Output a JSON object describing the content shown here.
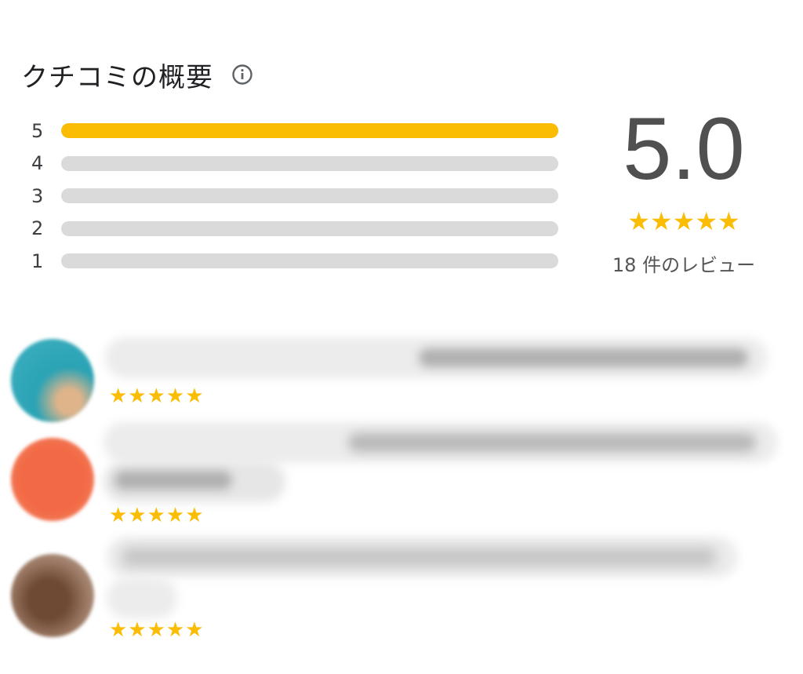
{
  "header": {
    "title": "クチコミの概要",
    "info_icon": "info-icon"
  },
  "histogram": {
    "rows": [
      {
        "label": "5",
        "fraction": 1.0
      },
      {
        "label": "4",
        "fraction": 0.0
      },
      {
        "label": "3",
        "fraction": 0.0
      },
      {
        "label": "2",
        "fraction": 0.0
      },
      {
        "label": "1",
        "fraction": 0.0
      }
    ]
  },
  "summary": {
    "score": "5.0",
    "stars": "★★★★★",
    "review_count": "18 件のレビュー"
  },
  "reviews": [
    {
      "stars": "★★★★★",
      "avatar_color": "#2a9fb3"
    },
    {
      "stars": "★★★★★",
      "avatar_color": "#f26a45"
    },
    {
      "stars": "★★★★★",
      "avatar_color": "#7a5a48"
    }
  ],
  "colors": {
    "accent": "#fbbc04",
    "bar_empty": "#dadada",
    "score_text": "#505050"
  }
}
